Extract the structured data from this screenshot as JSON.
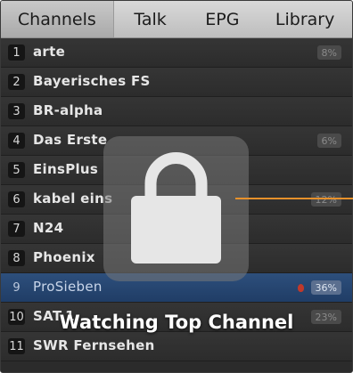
{
  "tabs": [
    {
      "label": "Channels"
    },
    {
      "label": "Talk"
    },
    {
      "label": "EPG"
    },
    {
      "label": "Library"
    }
  ],
  "channels": [
    {
      "number": "1",
      "name": "arte",
      "percent": "8%"
    },
    {
      "number": "2",
      "name": "Bayerisches FS",
      "percent": ""
    },
    {
      "number": "3",
      "name": "BR-alpha",
      "percent": ""
    },
    {
      "number": "4",
      "name": "Das Erste",
      "percent": "6%"
    },
    {
      "number": "5",
      "name": "EinsPlus",
      "percent": ""
    },
    {
      "number": "6",
      "name": "kabel eins",
      "percent": "12%"
    },
    {
      "number": "7",
      "name": "N24",
      "percent": ""
    },
    {
      "number": "8",
      "name": "Phoenix",
      "percent": ""
    },
    {
      "number": "9",
      "name": "ProSieben",
      "percent": "36%"
    },
    {
      "number": "10",
      "name": "SAT.1",
      "percent": "23%"
    },
    {
      "number": "11",
      "name": "SWR Fernsehen",
      "percent": ""
    }
  ],
  "selected_channel_index": 8,
  "overlay": {
    "icon": "lock-icon",
    "caption": "Watching Top Channel"
  },
  "colors": {
    "selected_row": "#203d66",
    "pointer_line": "#e8912b",
    "top_channel_marker": "#c0392b"
  }
}
